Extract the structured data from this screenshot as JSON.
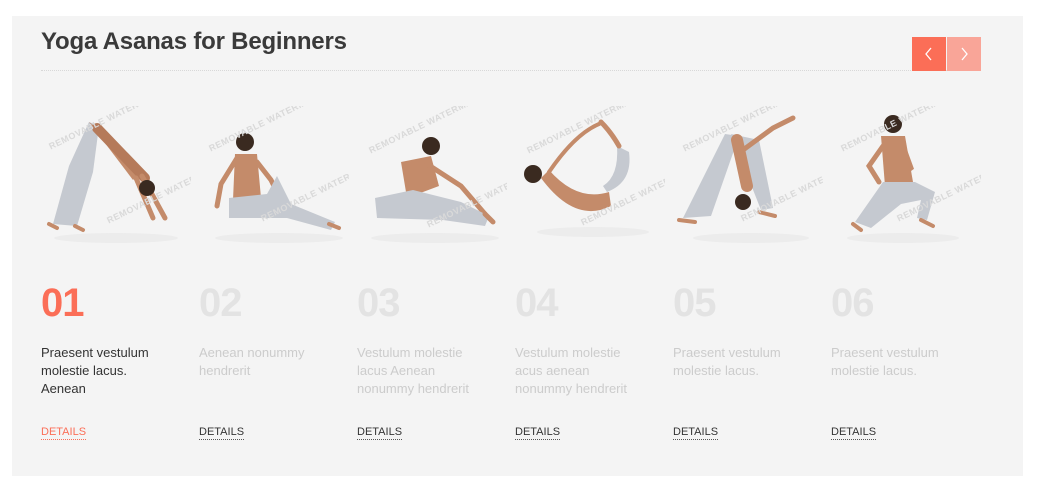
{
  "section": {
    "title": "Yoga Asanas for Beginners"
  },
  "nav": {
    "prev_icon": "chevron-left-icon",
    "next_icon": "chevron-right-icon"
  },
  "watermark": "REMOVABLE WATERMARK",
  "colors": {
    "accent": "#fb6e57",
    "accent_light": "#f9a598",
    "panel_bg": "#f4f4f4",
    "title": "#3a3a3a",
    "inactive_text": "#cccccc",
    "inactive_number": "#e3e3e3"
  },
  "cards": [
    {
      "number": "01",
      "description": "Praesent vestulum molestie lacus. Aenean",
      "link": "DETAILS",
      "pose": "downward-dog-pose",
      "active": true
    },
    {
      "number": "02",
      "description": "Aenean nonummy hendrerit",
      "link": "DETAILS",
      "pose": "seated-twist-pose",
      "active": false
    },
    {
      "number": "03",
      "description": "Vestulum molestie lacus Aenean nonummy hendrerit",
      "link": "DETAILS",
      "pose": "seated-forward-bend-pose",
      "active": false
    },
    {
      "number": "04",
      "description": "Vestulum molestie acus aenean nonummy hendrerit",
      "link": "DETAILS",
      "pose": "bow-pose",
      "active": false
    },
    {
      "number": "05",
      "description": "Praesent vestulum molestie lacus.",
      "link": "DETAILS",
      "pose": "pyramid-pose",
      "active": false
    },
    {
      "number": "06",
      "description": "Praesent vestulum molestie lacus.",
      "link": "DETAILS",
      "pose": "lunge-twist-pose",
      "active": false
    }
  ]
}
